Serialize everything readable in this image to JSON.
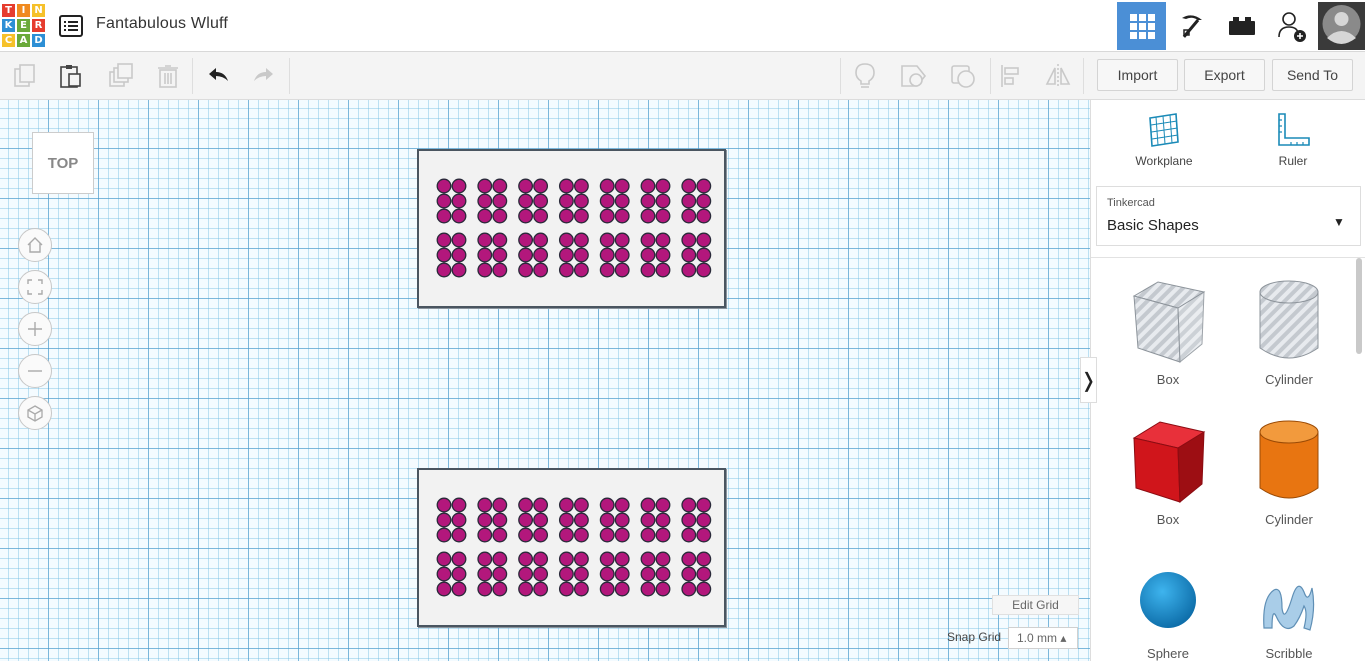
{
  "app": {
    "logo_letters": [
      "T",
      "I",
      "N",
      "K",
      "E",
      "R",
      "C",
      "A",
      "D"
    ],
    "logo_colors": [
      "#e63c2e",
      "#f08a1f",
      "#f6c12a",
      "#2d8fd5",
      "#6aaa3a",
      "#e63c2e",
      "#f6c12a",
      "#6aaa3a",
      "#2d8fd5"
    ],
    "document_title": "Fantabulous Wluff"
  },
  "header": {
    "buttons": [
      {
        "name": "3d-view-grid-icon",
        "active": true
      },
      {
        "name": "pickaxe-icon",
        "active": false
      },
      {
        "name": "bricks-icon",
        "active": false
      },
      {
        "name": "add-user-icon",
        "active": false
      }
    ],
    "accent_color": "#4b8fd6"
  },
  "toolbar": {
    "left_tools": [
      "copy-icon",
      "paste-icon",
      "duplicate-icon",
      "delete-icon",
      "undo-icon",
      "redo-icon"
    ],
    "right_tools": [
      "light-bulb-icon",
      "note-icon",
      "group-icon",
      "align-icon",
      "mirror-icon"
    ],
    "import_label": "Import",
    "export_label": "Export",
    "send_to_label": "Send To"
  },
  "viewport": {
    "view_cube_label": "TOP",
    "nav_buttons": [
      "home-view-icon",
      "fit-view-icon",
      "zoom-in-icon",
      "zoom-out-icon",
      "perspective-icon"
    ],
    "plates": [
      {
        "dot_color": "#b3177c",
        "groups_per_row": 7,
        "rows": 2
      },
      {
        "dot_color": "#b3177c",
        "groups_per_row": 7,
        "rows": 2
      }
    ],
    "edit_grid_label": "Edit Grid",
    "snap_grid_label": "Snap Grid",
    "snap_grid_value": "1.0 mm ▴"
  },
  "panel": {
    "workplane_label": "Workplane",
    "ruler_label": "Ruler",
    "library_category": "Tinkercad",
    "library_name": "Basic Shapes",
    "collapse_glyph": "❭",
    "shapes": [
      {
        "label": "Box",
        "kind": "hole-box"
      },
      {
        "label": "Cylinder",
        "kind": "hole-cylinder"
      },
      {
        "label": "Box",
        "kind": "solid-box",
        "color": "#d0151b"
      },
      {
        "label": "Cylinder",
        "kind": "solid-cylinder",
        "color": "#e87511"
      },
      {
        "label": "Sphere",
        "kind": "sphere",
        "color": "#1588c9"
      },
      {
        "label": "Scribble",
        "kind": "scribble",
        "color": "#a9cde8"
      }
    ]
  }
}
